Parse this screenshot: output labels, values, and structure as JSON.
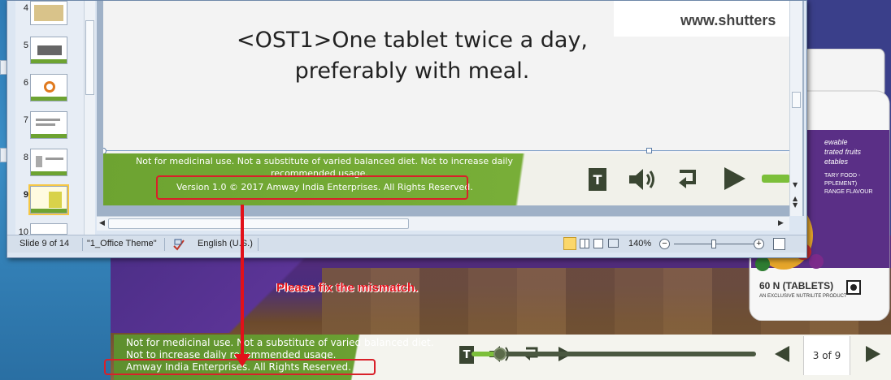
{
  "slide": {
    "main_text_line1": "<OST1>One tablet twice a day,",
    "main_text_line2": "preferably with meal.",
    "watermark": "www.shutters",
    "disclaimer_line1": "Not for medicinal use. Not a substitute of varied balanced diet. Not to increase daily",
    "disclaimer_line2": "recommended usage.",
    "copyright": "Version 1.0 © 2017 Amway India Enterprises. All Rights Reserved.",
    "t_button": "T"
  },
  "thumbnails": {
    "numbers": [
      "4",
      "5",
      "6",
      "7",
      "8",
      "9",
      "10"
    ],
    "active": "9"
  },
  "statusbar": {
    "slide_info": "Slide 9 of 14",
    "theme": "\"1_Office Theme\"",
    "language": "English (U.S.)",
    "zoom": "140%"
  },
  "player": {
    "disclaimer_line1": "Not for medicinal use. Not a substitute of varied balanced diet.",
    "disclaimer_line2": "Not to increase daily recommended usage.",
    "copyright": "Amway India Enterprises. All Rights Reserved.",
    "t_button": "T",
    "page_counter": "3 of 9",
    "progress": 0.1
  },
  "annotation": {
    "note": "Please fix the mismatch."
  },
  "product": {
    "label_top": "ewable",
    "label_line2": "trated fruits",
    "label_line3": "etables",
    "label_food": "TARY FOOD -",
    "label_supp": "PPLEMENT)",
    "label_flavour": "RANGE FLAVOUR",
    "count": "60 N (TABLETS)",
    "tagline": "AN EXCLUSIVE NUTRILITE PRODUCT"
  },
  "colors": {
    "accent_green": "#6da331",
    "annotation_red": "#e2111a"
  }
}
